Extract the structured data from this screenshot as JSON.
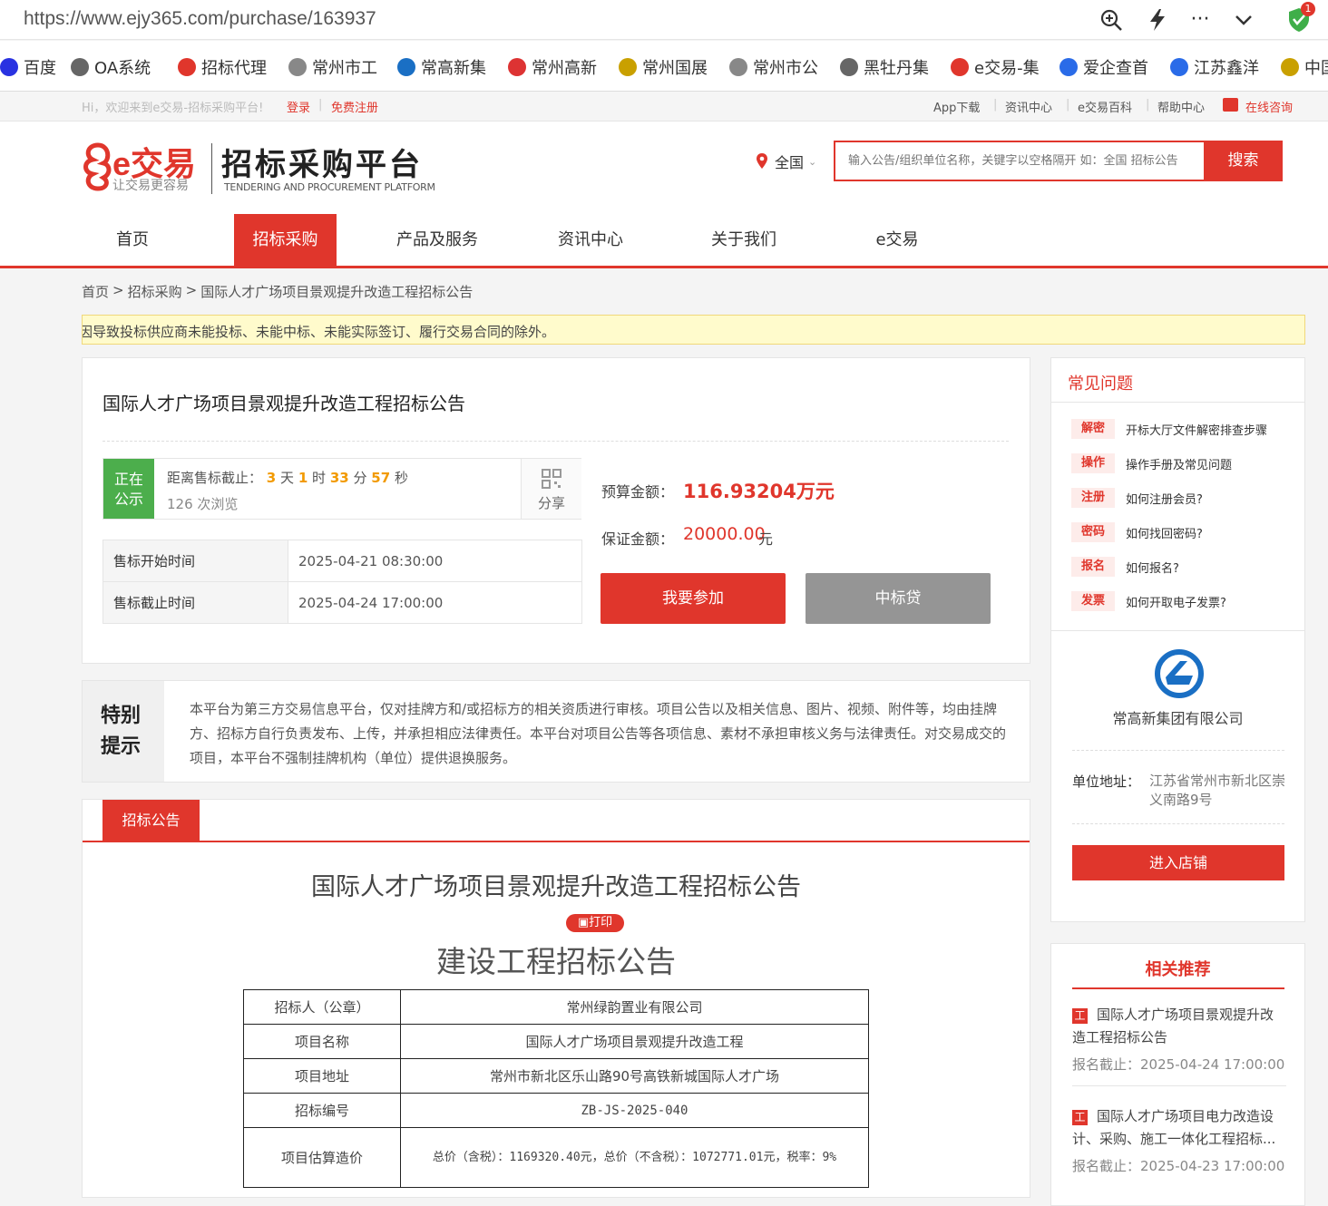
{
  "browser": {
    "url": "https://www.ejy365.com/purchase/163937",
    "badge": "1"
  },
  "bookmarks": [
    {
      "label": "百度",
      "icon": "baidu-icon",
      "color": "#2932e1"
    },
    {
      "label": "OA系统",
      "icon": "oa-icon",
      "color": "#666"
    },
    {
      "label": "招标代理",
      "icon": "pdf-icon",
      "color": "#e0362c"
    },
    {
      "label": "常州市工",
      "icon": "globe-icon",
      "color": "#888"
    },
    {
      "label": "常高新集",
      "icon": "changgao-icon",
      "color": "#1a6fc4"
    },
    {
      "label": "常州高新",
      "icon": "emblem-icon",
      "color": "#d33"
    },
    {
      "label": "常州国展",
      "icon": "national-emblem-icon",
      "color": "#c9a000"
    },
    {
      "label": "常州市公",
      "icon": "globe-icon",
      "color": "#888"
    },
    {
      "label": "黑牡丹集",
      "icon": "oa-icon",
      "color": "#666"
    },
    {
      "label": "e交易-集",
      "icon": "ejy-icon",
      "color": "#e0362c"
    },
    {
      "label": "爱企查首",
      "icon": "aiqicha-icon",
      "color": "#2a6be8"
    },
    {
      "label": "江苏鑫洋",
      "icon": "aiqicha-icon",
      "color": "#2a6be8"
    },
    {
      "label": "中国",
      "icon": "national-emblem-icon",
      "color": "#c9a000"
    }
  ],
  "topbar": {
    "welcome": "Hi，欢迎来到e交易-招标采购平台!",
    "login": "登录",
    "register": "免费注册",
    "links": [
      "App下载",
      "资讯中心",
      "e交易百科",
      "帮助中心"
    ],
    "consult": "在线咨询"
  },
  "header": {
    "logo_text": "e交易",
    "logo_slogan": "让交易更容易",
    "platform_title": "招标采购平台",
    "platform_subtitle": "TENDERING AND PROCUREMENT PLATFORM",
    "region": "全国",
    "search_placeholder": "输入公告/组织单位名称，关键字以空格隔开 如：全国 招标公告",
    "search_button": "搜索"
  },
  "nav": [
    "首页",
    "招标采购",
    "产品及服务",
    "资讯中心",
    "关于我们",
    "e交易"
  ],
  "breadcrumb": [
    "首页",
    "招标采购",
    "国际人才广场项目景观提升改造工程招标公告"
  ],
  "notice_bar": "因导致投标供应商未能投标、未能中标、未能实际签订、履行交易合同的除外。",
  "project": {
    "title": "国际人才广场项目景观提升改造工程招标公告",
    "status": "正在公示",
    "countdown_label": "距离售标截止：",
    "days": "3",
    "hours": "1",
    "minutes": "33",
    "seconds": "57",
    "u_day": "天",
    "u_hour": "时",
    "u_min": "分",
    "u_sec": "秒",
    "views": "126",
    "views_unit": "次浏览",
    "share": "分享",
    "sale_start_label": "售标开始时间",
    "sale_start": "2025-04-21 08:30:00",
    "sale_end_label": "售标截止时间",
    "sale_end": "2025-04-24 17:00:00",
    "budget_label": "预算金额：",
    "budget": "116.93204万元",
    "deposit_label": "保证金额：",
    "deposit": "20000.00",
    "deposit_unit": "元",
    "join_button": "我要参加",
    "loan_button": "中标贷"
  },
  "special_notice": {
    "title": "特别提示",
    "text": "本平台为第三方交易信息平台，仅对挂牌方和/或招标方的相关资质进行审核。项目公告以及相关信息、图片、视频、附件等，均由挂牌方、招标方自行负责发布、上传，并承担相应法律责任。本平台对项目公告等各项信息、素材不承担审核义务与法律责任。对交易成交的项目，本平台不强制挂牌机构（单位）提供退换服务。"
  },
  "announcement": {
    "tab": "招标公告",
    "title": "国际人才广场项目景观提升改造工程招标公告",
    "print": "打印",
    "doc_title": "建设工程招标公告",
    "rows": [
      {
        "label": "招标人（公章）",
        "value": "常州绿韵置业有限公司"
      },
      {
        "label": "项目名称",
        "value": "国际人才广场项目景观提升改造工程"
      },
      {
        "label": "项目地址",
        "value": "常州市新北区乐山路90号高铁新城国际人才广场"
      },
      {
        "label": "招标编号",
        "value": "ZB-JS-2025-040"
      },
      {
        "label": "项目估算造价",
        "value": "总价（含税）：1169320.40元，总价（不含税）：1072771.01元，税率：9%"
      }
    ]
  },
  "faq": {
    "title": "常见问题",
    "items": [
      {
        "tag": "解密",
        "text": "开标大厅文件解密排查步骤"
      },
      {
        "tag": "操作",
        "text": "操作手册及常见问题"
      },
      {
        "tag": "注册",
        "text": "如何注册会员?"
      },
      {
        "tag": "密码",
        "text": "如何找回密码?"
      },
      {
        "tag": "报名",
        "text": "如何报名?"
      },
      {
        "tag": "发票",
        "text": "如何开取电子发票?"
      }
    ]
  },
  "company": {
    "name": "常高新集团有限公司",
    "address_label": "单位地址：",
    "address": "江苏省常州市新北区崇义南路9号",
    "shop_button": "进入店铺"
  },
  "related": {
    "title": "相关推荐",
    "items": [
      {
        "tag": "工",
        "title": "国际人才广场项目景观提升改造工程招标公告",
        "deadline_label": "报名截止：",
        "deadline": "2025-04-24 17:00:00"
      },
      {
        "tag": "工",
        "title": "国际人才广场项目电力改造设计、采购、施工一体化工程招标...",
        "deadline_label": "报名截止：",
        "deadline": "2025-04-23 17:00:00"
      }
    ]
  },
  "colors": {
    "brand_red": "#e0362c",
    "status_green": "#4cae4c",
    "countdown_orange": "#f29a00",
    "notice_bg": "#fffbcc"
  }
}
